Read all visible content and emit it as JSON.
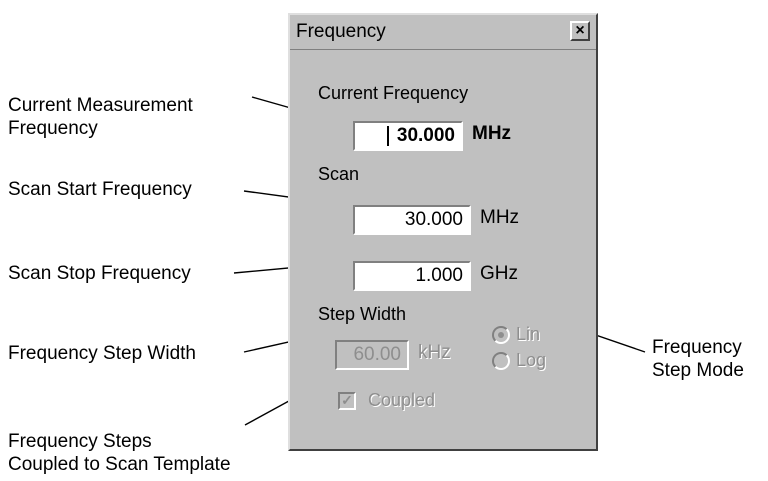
{
  "annotations": {
    "current_measurement_l1": "Current Measurement",
    "current_measurement_l2": "Frequency",
    "scan_start": "Scan Start Frequency",
    "scan_stop": "Scan Stop Frequency",
    "step_width": "Frequency Step Width",
    "step_mode_l1": "Frequency",
    "step_mode_l2": "Step Mode",
    "coupled_l1": "Frequency Steps",
    "coupled_l2": "Coupled to Scan Template"
  },
  "dialog": {
    "title": "Frequency",
    "close_glyph": "×",
    "current_frequency": {
      "label": "Current Frequency",
      "value": "30.000",
      "unit": "MHz"
    },
    "scan": {
      "label": "Scan",
      "start": {
        "value": "30.000",
        "unit": "MHz"
      },
      "stop": {
        "value": "1.000",
        "unit": "GHz"
      }
    },
    "step_width": {
      "label": "Step Width",
      "value": "60.00",
      "unit": "kHz",
      "enabled": false
    },
    "step_mode": {
      "options": [
        "Lin",
        "Log"
      ],
      "selected": "Lin",
      "enabled": false
    },
    "coupled": {
      "label": "Coupled",
      "checked": true,
      "enabled": false
    }
  },
  "colors": {
    "face": "#c0c0c0",
    "disabled_text": "#8e8e8e",
    "highlight": "#ffffff",
    "shadow": "#808080"
  }
}
